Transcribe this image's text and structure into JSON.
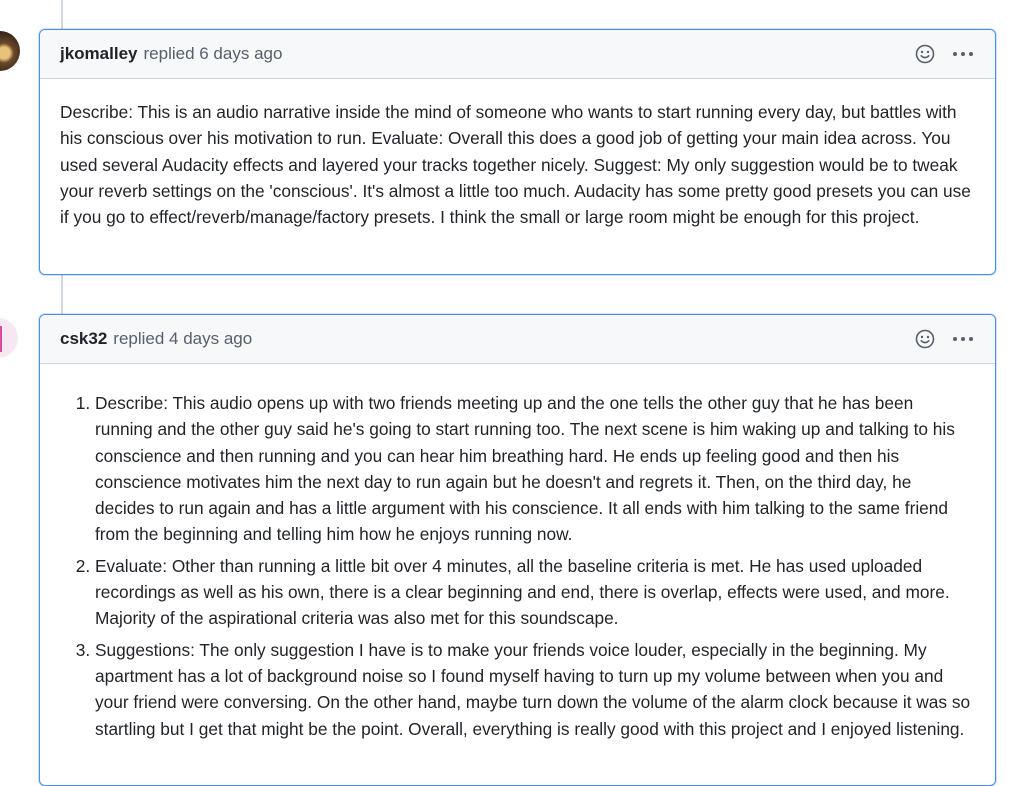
{
  "comments": [
    {
      "author": "jkomalley",
      "meta": "replied 6 days ago",
      "body": "Describe: This is an audio narrative inside the mind of someone who wants to start running every day, but battles with his conscious over his motivation to run. Evaluate: Overall this does a good job of getting your main idea across. You used several Audacity effects and layered your tracks together nicely. Suggest: My only suggestion would be to tweak your reverb settings on the 'conscious'. It's almost a little too much. Audacity has some pretty good presets you can use if you go to effect/reverb/manage/factory presets. I think the small or large room might be enough for this project."
    },
    {
      "author": "csk32",
      "meta": "replied 4 days ago",
      "items": [
        "Describe: This audio opens up with two friends meeting up and the one tells the other guy that he has been running and the other guy said he's going to start running too. The next scene is him waking up and talking to his conscience and then running and you can hear him breathing hard. He ends up feeling good and then his conscience motivates him the next day to run again but he doesn't and regrets it. Then, on the third day, he decides to run again and has a little argument with his conscience. It all ends with him talking to the same friend from the beginning and telling him how he enjoys running now.",
        "Evaluate: Other than running a little bit over 4 minutes, all the baseline criteria is met. He has used uploaded recordings as well as his own, there is a clear beginning and end, there is overlap, effects were used, and more. Majority of the aspirational criteria was also met for this soundscape.",
        "Suggestions: The only suggestion I have is to make your friends voice louder, especially in the beginning. My apartment has a lot of background noise so I found myself having to turn up my volume between when you and your friend were conversing. On the other hand, maybe turn down the volume of the alarm clock because it was so startling but I get that might be the point. Overall, everything is really good with this project and I enjoyed listening."
      ]
    }
  ],
  "icons": {
    "reaction": "smiley-icon",
    "menu": "kebab-icon"
  },
  "colors": {
    "focus_border": "#4a90e2",
    "header_bg": "#f6f8fa"
  }
}
